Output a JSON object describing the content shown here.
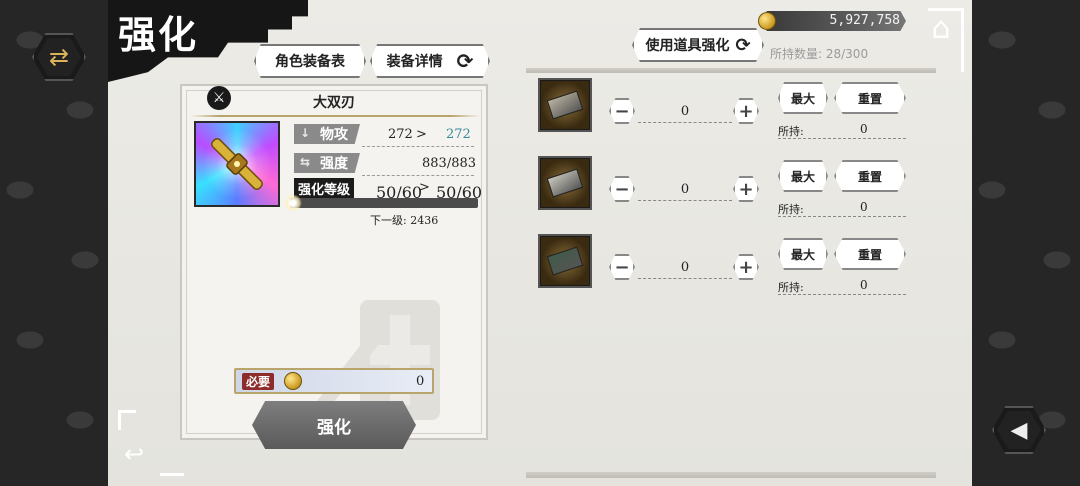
{
  "screen": {
    "title": "强化",
    "tabs": [
      {
        "label": "角色装备表"
      },
      {
        "label": "装备详情",
        "icon": "refresh-icon"
      }
    ]
  },
  "weapon": {
    "name": "大双刃",
    "type_icon": "sword-icon",
    "stats": [
      {
        "label": "物攻",
        "current": "272",
        "arrow": ">",
        "next": "272"
      },
      {
        "label": "强度",
        "value": "883/883"
      }
    ],
    "level_label": "强化等级",
    "level_current": "50/60",
    "level_arrow": ">",
    "level_next": "50/60",
    "next_level_text": "下一级: 2436",
    "required_label": "必要",
    "required_cost": "0",
    "enhance_button": "强化"
  },
  "right_panel": {
    "title": "使用道具强化",
    "gold": "5,927,758",
    "holding": "所持数量: 28/300",
    "items": [
      {
        "stone_color": "#b9b2a0",
        "quantity": "0",
        "max_label": "最大",
        "reset_label": "重置",
        "owned_label": "所持:",
        "owned": "0"
      },
      {
        "stone_color": "#c8c6bc",
        "quantity": "0",
        "max_label": "最大",
        "reset_label": "重置",
        "owned_label": "所持:",
        "owned": "0"
      },
      {
        "stone_color": "#3f5a48",
        "quantity": "0",
        "max_label": "最大",
        "reset_label": "重置",
        "owned_label": "所持:",
        "owned": "0"
      }
    ]
  },
  "icons": {
    "swap": "swap-icon",
    "home": "home-icon",
    "back": "back-icon",
    "sound": "speaker-icon",
    "minus": "minus-icon",
    "plus": "plus-icon",
    "coin": "coin-icon"
  }
}
